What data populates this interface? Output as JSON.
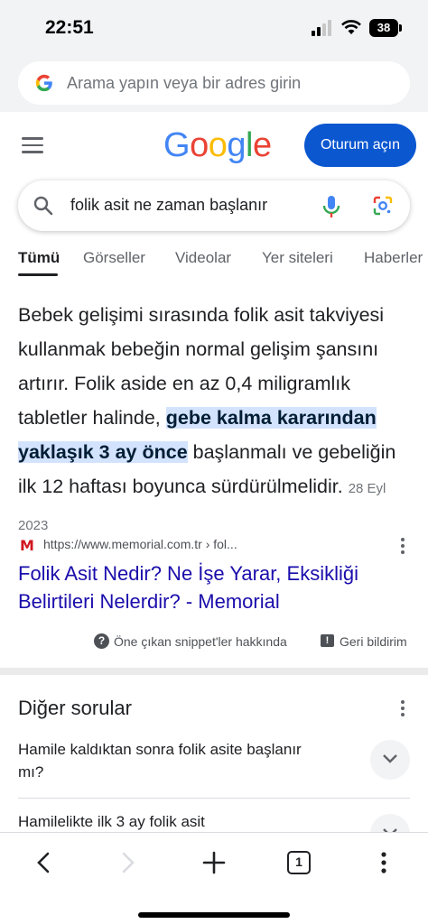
{
  "status_bar": {
    "time": "22:51",
    "battery": "38"
  },
  "address_bar": {
    "placeholder": "Arama yapın veya bir adres girin"
  },
  "header": {
    "logo": [
      "G",
      "o",
      "o",
      "g",
      "l",
      "e"
    ],
    "logo_colors": [
      "#4285f4",
      "#ea4335",
      "#fbbc05",
      "#4285f4",
      "#34a853",
      "#ea4335"
    ],
    "signin_label": "Oturum açın"
  },
  "search": {
    "query": "folik asit ne zaman başlanır"
  },
  "tabs": [
    "Tümü",
    "Görseller",
    "Videolar",
    "Yer siteleri",
    "Haberler"
  ],
  "snippet": {
    "text_before": "Bebek gelişimi sırasında folik asit takviyesi kullanmak bebeğin normal gelişim şansını artırır. Folik aside en az 0,4 miligramlık tabletler halinde, ",
    "highlight": "gebe kalma kararından yaklaşık 3 ay önce",
    "text_after": " başlanmalı ve gebeliğin ilk 12 haftası boyunca sürdürülmelidir.",
    "date": "28 Eyl 2023"
  },
  "result": {
    "favicon": "M",
    "url": "https://www.memorial.com.tr › fol...",
    "title": "Folik Asit Nedir? Ne İşe Yarar, Eksikliği Belirtileri Nelerdir? - Memorial"
  },
  "footer_links": {
    "about": "Öne çıkan snippet'ler hakkında",
    "feedback": "Geri bildirim"
  },
  "other_questions": {
    "title": "Diğer sorular",
    "items": [
      "Hamile kaldıktan sonra folik asite başlanır mı?",
      "Hamilelikte ilk 3 ay folik asit"
    ]
  },
  "bottom_bar": {
    "tab_count": "1"
  },
  "colors": {
    "accent": "#0b57d0",
    "link": "#1a0dab",
    "highlight": "#d3e3fd"
  }
}
